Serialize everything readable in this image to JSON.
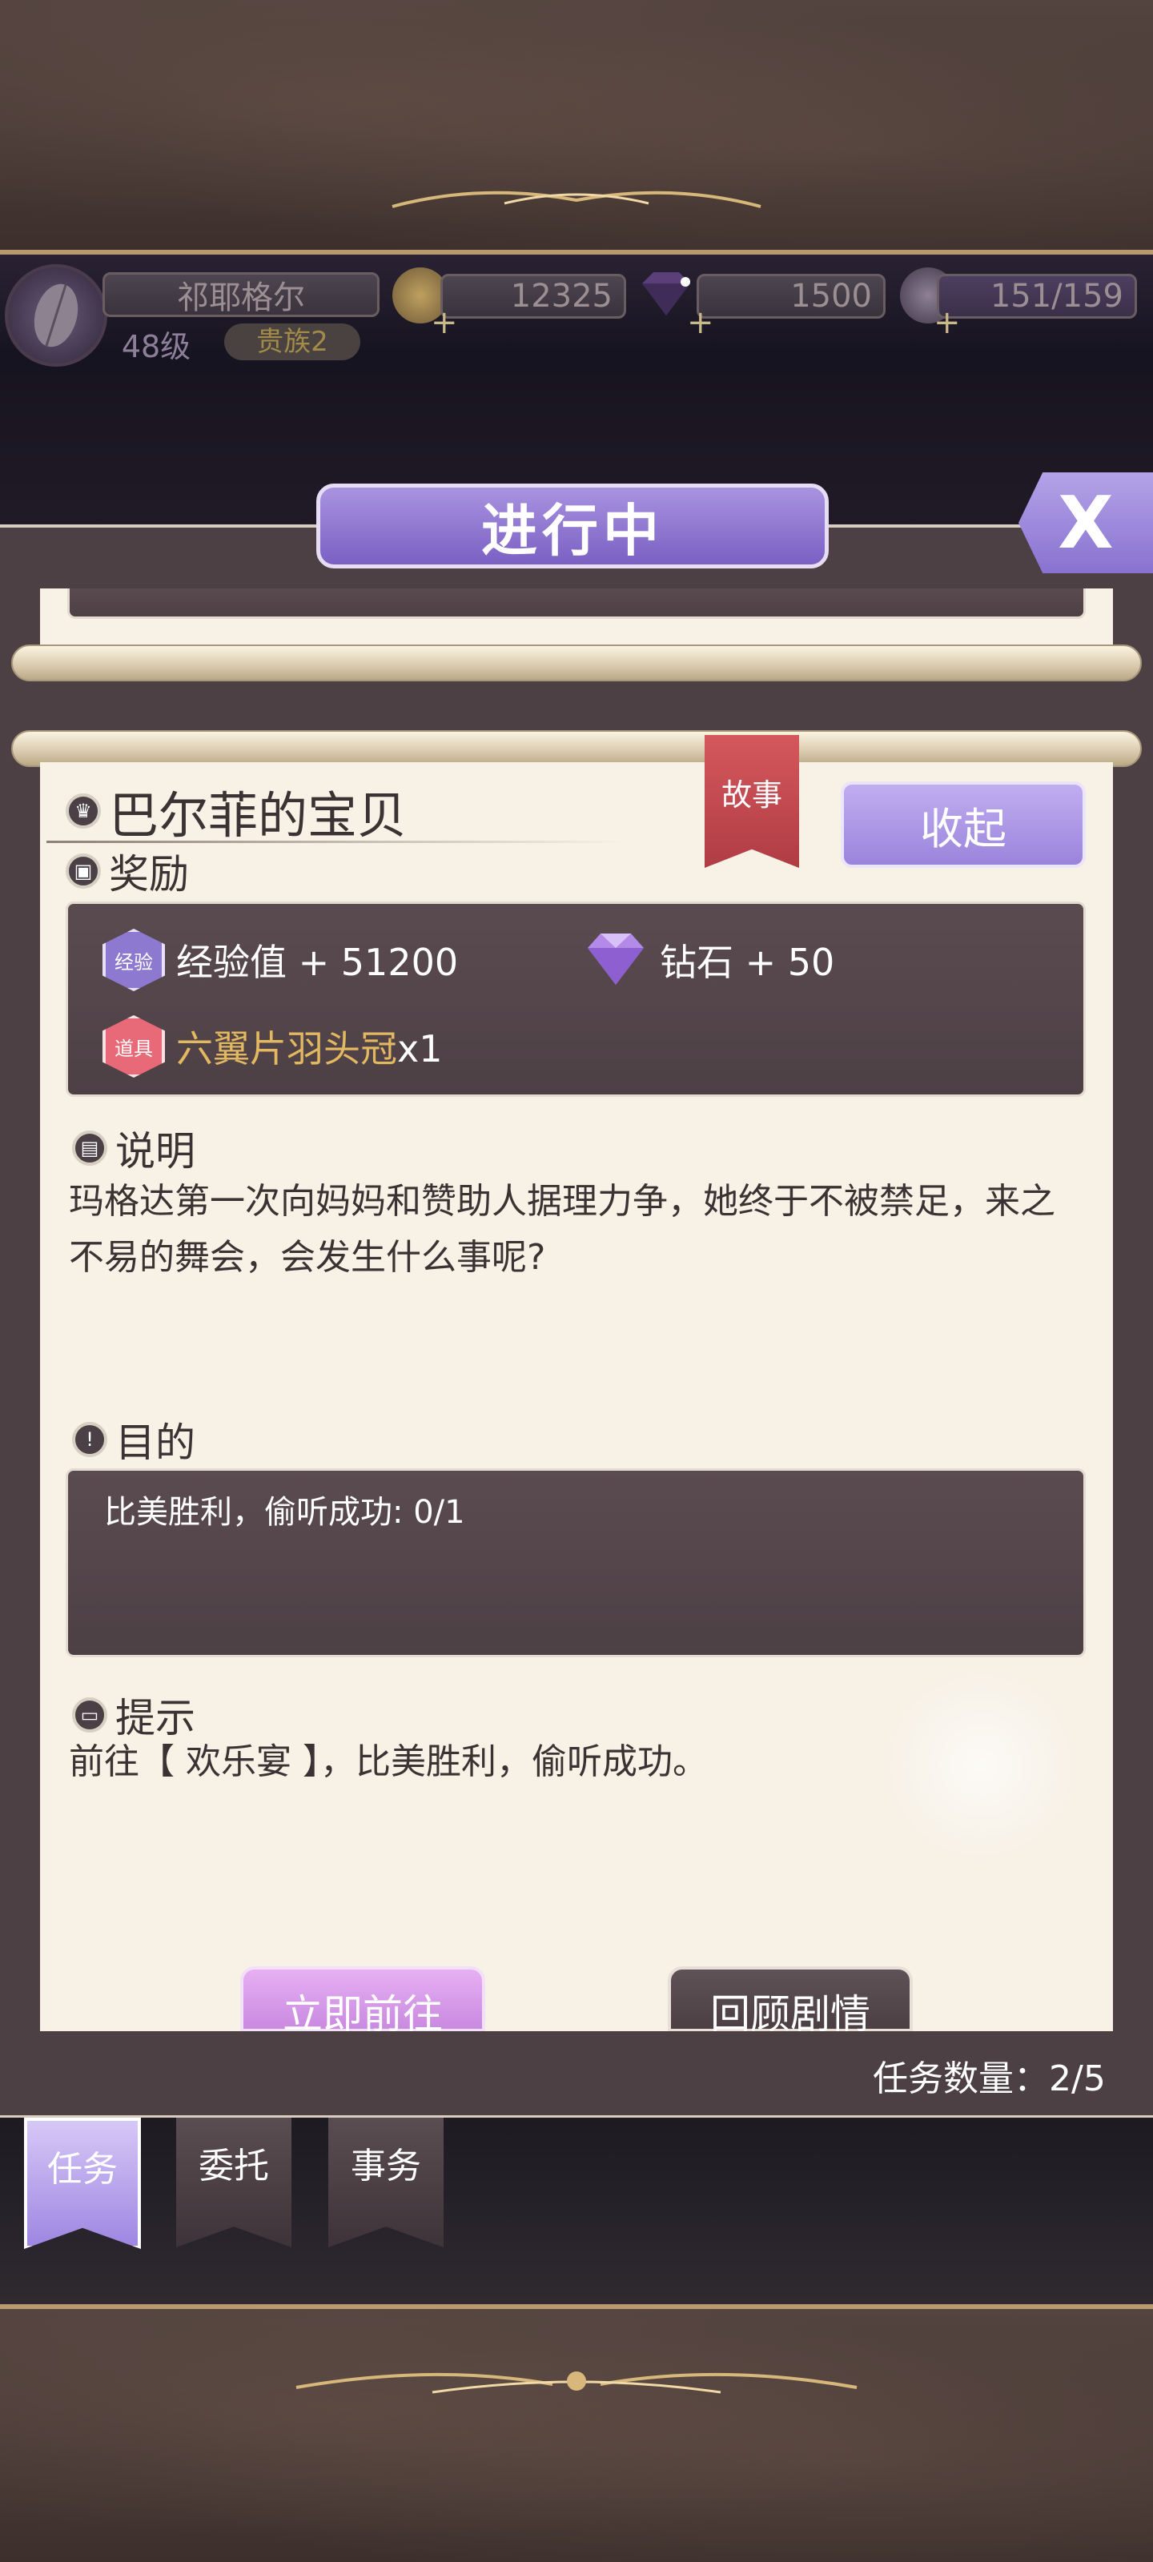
{
  "player": {
    "name": "祁耶格尔",
    "level": "48级",
    "rank": "贵族2"
  },
  "resources": {
    "gold": "12325",
    "diamond": "1500",
    "stamina": "151/159"
  },
  "window": {
    "title": "进行中",
    "close_label": "X"
  },
  "quest": {
    "title": "巴尔菲的宝贝",
    "tag": "故事",
    "collapse_label": "收起",
    "reward_label": "奖励",
    "rewards": [
      {
        "icon": "exp-badge-icon",
        "icon_text": "经验",
        "name": "经验值",
        "amount": "+ 51200"
      },
      {
        "icon": "diamond-icon",
        "name": "钻石",
        "amount": "+ 50"
      },
      {
        "icon": "item-badge-icon",
        "icon_text": "道具",
        "name": "六翼片羽头冠",
        "amount": "x1"
      }
    ],
    "desc_label": "说明",
    "desc_text": "玛格达第一次向妈妈和赞助人据理力争，她终于不被禁足，来之不易的舞会，会发生什么事呢?",
    "goal_label": "目的",
    "goal_text": "比美胜利，偷听成功: 0/1",
    "hint_label": "提示",
    "hint_text": "前往【 欢乐宴 】，比美胜利，偷听成功。",
    "go_label": "立即前往",
    "review_label": "回顾剧情"
  },
  "task_count": "任务数量：2/5",
  "tabs": [
    {
      "label": "任务",
      "active": true
    },
    {
      "label": "委托",
      "active": false
    },
    {
      "label": "事务",
      "active": false
    }
  ],
  "colors": {
    "accent_purple": "#9a84dc",
    "gold_text": "#c9a24a",
    "panel_dark": "#4d4045",
    "paper": "#f7f1e6"
  }
}
